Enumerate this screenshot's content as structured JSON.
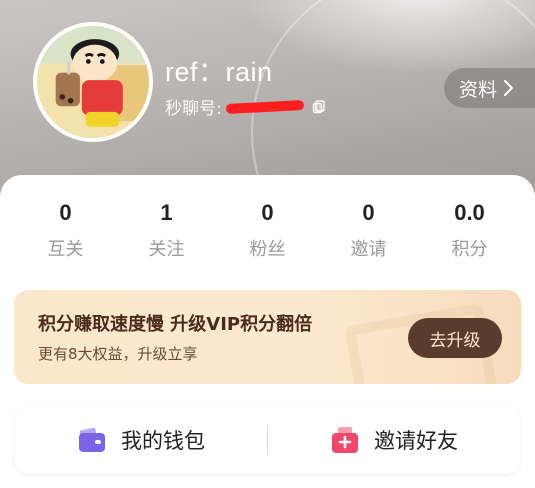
{
  "profile": {
    "name": "ref：rain",
    "id_label": "秒聊号:",
    "info_button": "资料"
  },
  "stats": [
    {
      "value": "0",
      "label": "互关"
    },
    {
      "value": "1",
      "label": "关注"
    },
    {
      "value": "0",
      "label": "粉丝"
    },
    {
      "value": "0",
      "label": "邀请"
    },
    {
      "value": "0.0",
      "label": "积分"
    }
  ],
  "vip": {
    "title": "积分赚取速度慢 升级VIP积分翻倍",
    "subtitle": "更有8大权益，升级立享",
    "button": "去升级"
  },
  "quick_actions": [
    {
      "label": "我的钱包",
      "icon": "wallet-icon",
      "color": "#7b63e8"
    },
    {
      "label": "邀请好友",
      "icon": "gift-bag-icon",
      "color": "#f0476a"
    }
  ]
}
